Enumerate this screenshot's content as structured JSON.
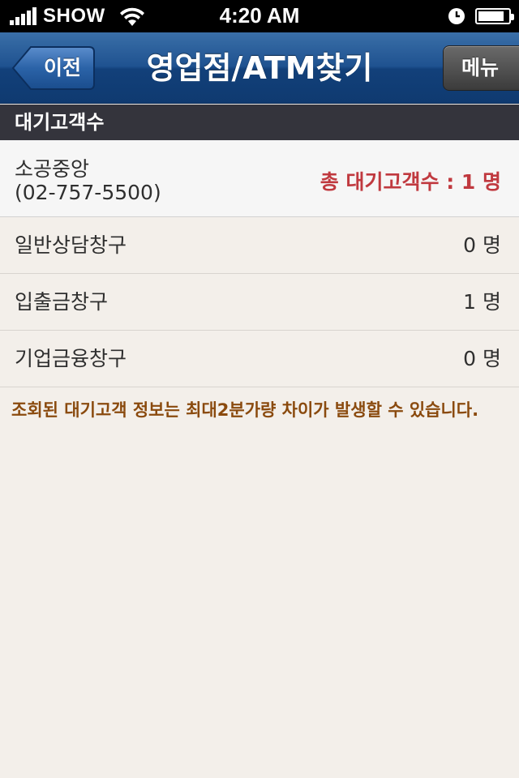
{
  "status_bar": {
    "carrier": "SHOW",
    "time": "4:20 AM",
    "battery_level": 0.85,
    "icons": [
      "signal-icon",
      "wifi-icon",
      "clock-icon",
      "battery-icon"
    ]
  },
  "nav": {
    "back_label": "이전",
    "title": "영업점/ATM찾기",
    "menu_label": "메뉴"
  },
  "section": {
    "title": "대기고객수"
  },
  "branch": {
    "name": "소공중앙",
    "phone": "(02-757-5500)",
    "total_waiting": "총 대기고객수 : 1 명"
  },
  "counters": [
    {
      "name": "일반상담창구",
      "count": "0 명"
    },
    {
      "name": "입출금창구",
      "count": "1 명"
    },
    {
      "name": "기업금융창구",
      "count": "0 명"
    }
  ],
  "notice": "조회된 대기고객 정보는 최대2분가량 차이가 발생할 수 있습니다.",
  "colors": {
    "nav_blue": "#1f5290",
    "section_bg": "#34343c",
    "total_red": "#c0393f",
    "notice_brown": "#8a4a0e",
    "page_bg": "#f3efea"
  }
}
